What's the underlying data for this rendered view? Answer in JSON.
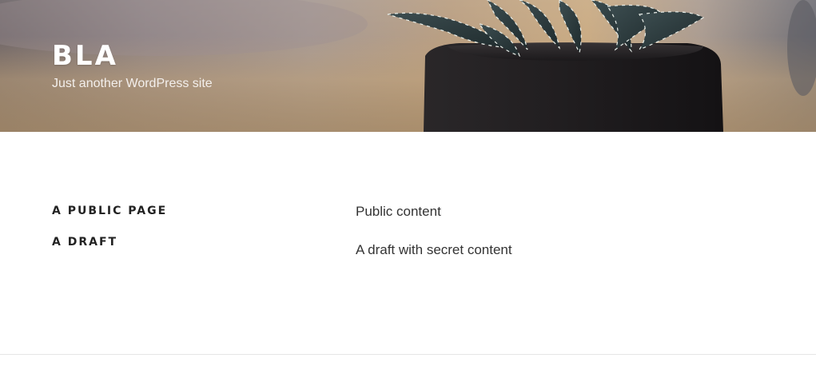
{
  "site": {
    "title": "BLA",
    "description": "Just another WordPress site"
  },
  "posts": [
    {
      "title": "A PUBLIC PAGE",
      "content": "Public content"
    },
    {
      "title": "A DRAFT",
      "content": "A draft with secret content"
    }
  ],
  "colors": {
    "title_text": "#ffffff",
    "heading_text": "#222222",
    "body_text": "#333333",
    "pot": "#1c1a1c",
    "plant_leaf": "#2d3c3e"
  }
}
